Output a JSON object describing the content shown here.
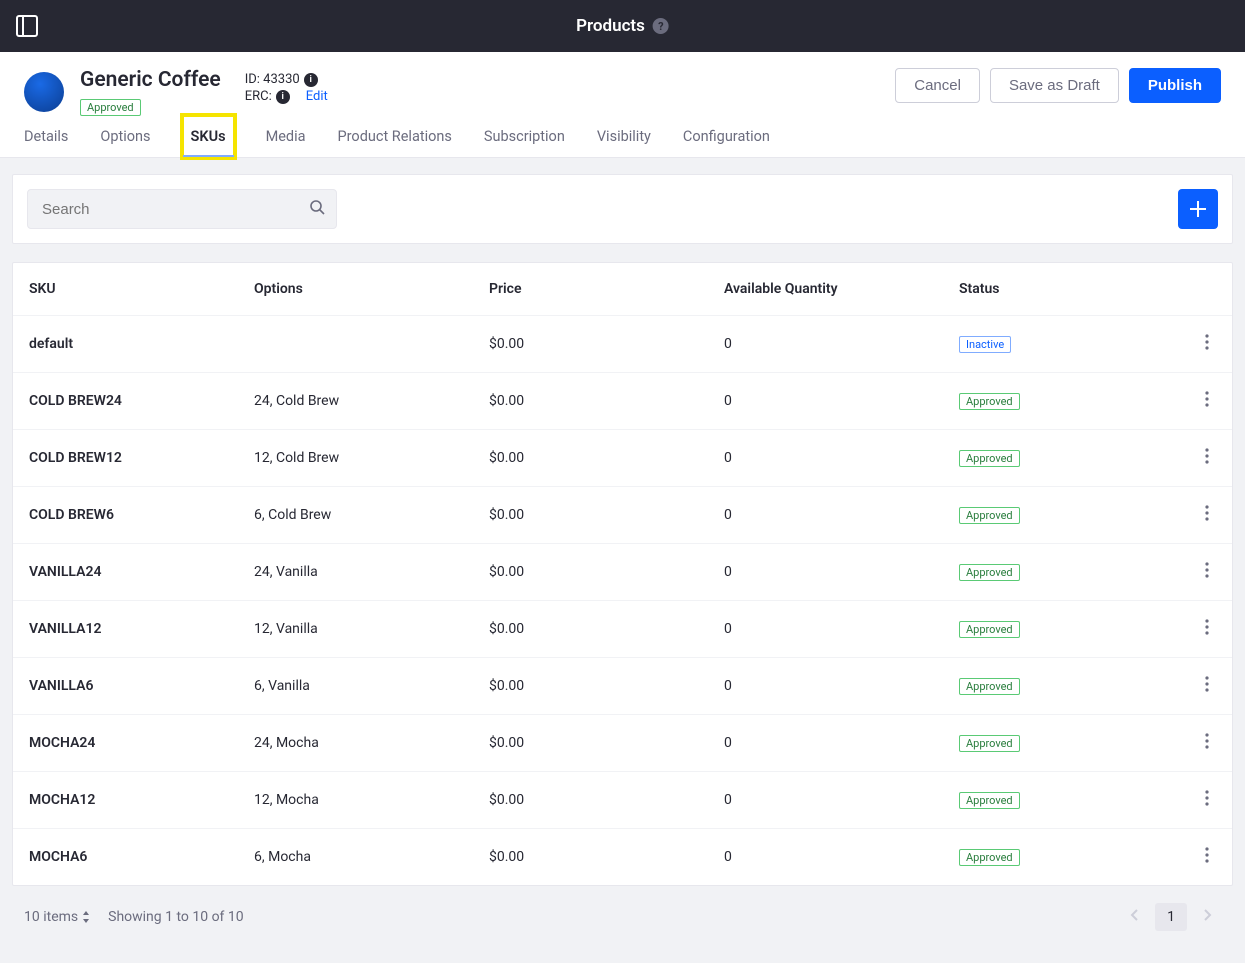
{
  "topbar": {
    "title": "Products"
  },
  "product": {
    "name": "Generic Coffee",
    "status_label": "Approved",
    "id_label": "ID: 43330",
    "erc_label": "ERC:",
    "edit_label": "Edit"
  },
  "buttons": {
    "cancel": "Cancel",
    "save_draft": "Save as Draft",
    "publish": "Publish"
  },
  "tabs": {
    "details": "Details",
    "options": "Options",
    "skus": "SKUs",
    "media": "Media",
    "relations": "Product Relations",
    "subscription": "Subscription",
    "visibility": "Visibility",
    "configuration": "Configuration"
  },
  "search": {
    "placeholder": "Search"
  },
  "columns": {
    "sku": "SKU",
    "options": "Options",
    "price": "Price",
    "qty": "Available Quantity",
    "status": "Status"
  },
  "status_labels": {
    "inactive": "Inactive",
    "approved": "Approved"
  },
  "rows": [
    {
      "sku": "default",
      "options": "",
      "price": "$0.00",
      "qty": "0",
      "status": "inactive"
    },
    {
      "sku": "COLD BREW24",
      "options": "24, Cold Brew",
      "price": "$0.00",
      "qty": "0",
      "status": "approved"
    },
    {
      "sku": "COLD BREW12",
      "options": "12, Cold Brew",
      "price": "$0.00",
      "qty": "0",
      "status": "approved"
    },
    {
      "sku": "COLD BREW6",
      "options": "6, Cold Brew",
      "price": "$0.00",
      "qty": "0",
      "status": "approved"
    },
    {
      "sku": "VANILLA24",
      "options": "24, Vanilla",
      "price": "$0.00",
      "qty": "0",
      "status": "approved"
    },
    {
      "sku": "VANILLA12",
      "options": "12, Vanilla",
      "price": "$0.00",
      "qty": "0",
      "status": "approved"
    },
    {
      "sku": "VANILLA6",
      "options": "6, Vanilla",
      "price": "$0.00",
      "qty": "0",
      "status": "approved"
    },
    {
      "sku": "MOCHA24",
      "options": "24, Mocha",
      "price": "$0.00",
      "qty": "0",
      "status": "approved"
    },
    {
      "sku": "MOCHA12",
      "options": "12, Mocha",
      "price": "$0.00",
      "qty": "0",
      "status": "approved"
    },
    {
      "sku": "MOCHA6",
      "options": "6, Mocha",
      "price": "$0.00",
      "qty": "0",
      "status": "approved"
    }
  ],
  "pagination": {
    "items": "10 items",
    "showing": "Showing 1 to 10 of 10",
    "current": "1"
  }
}
